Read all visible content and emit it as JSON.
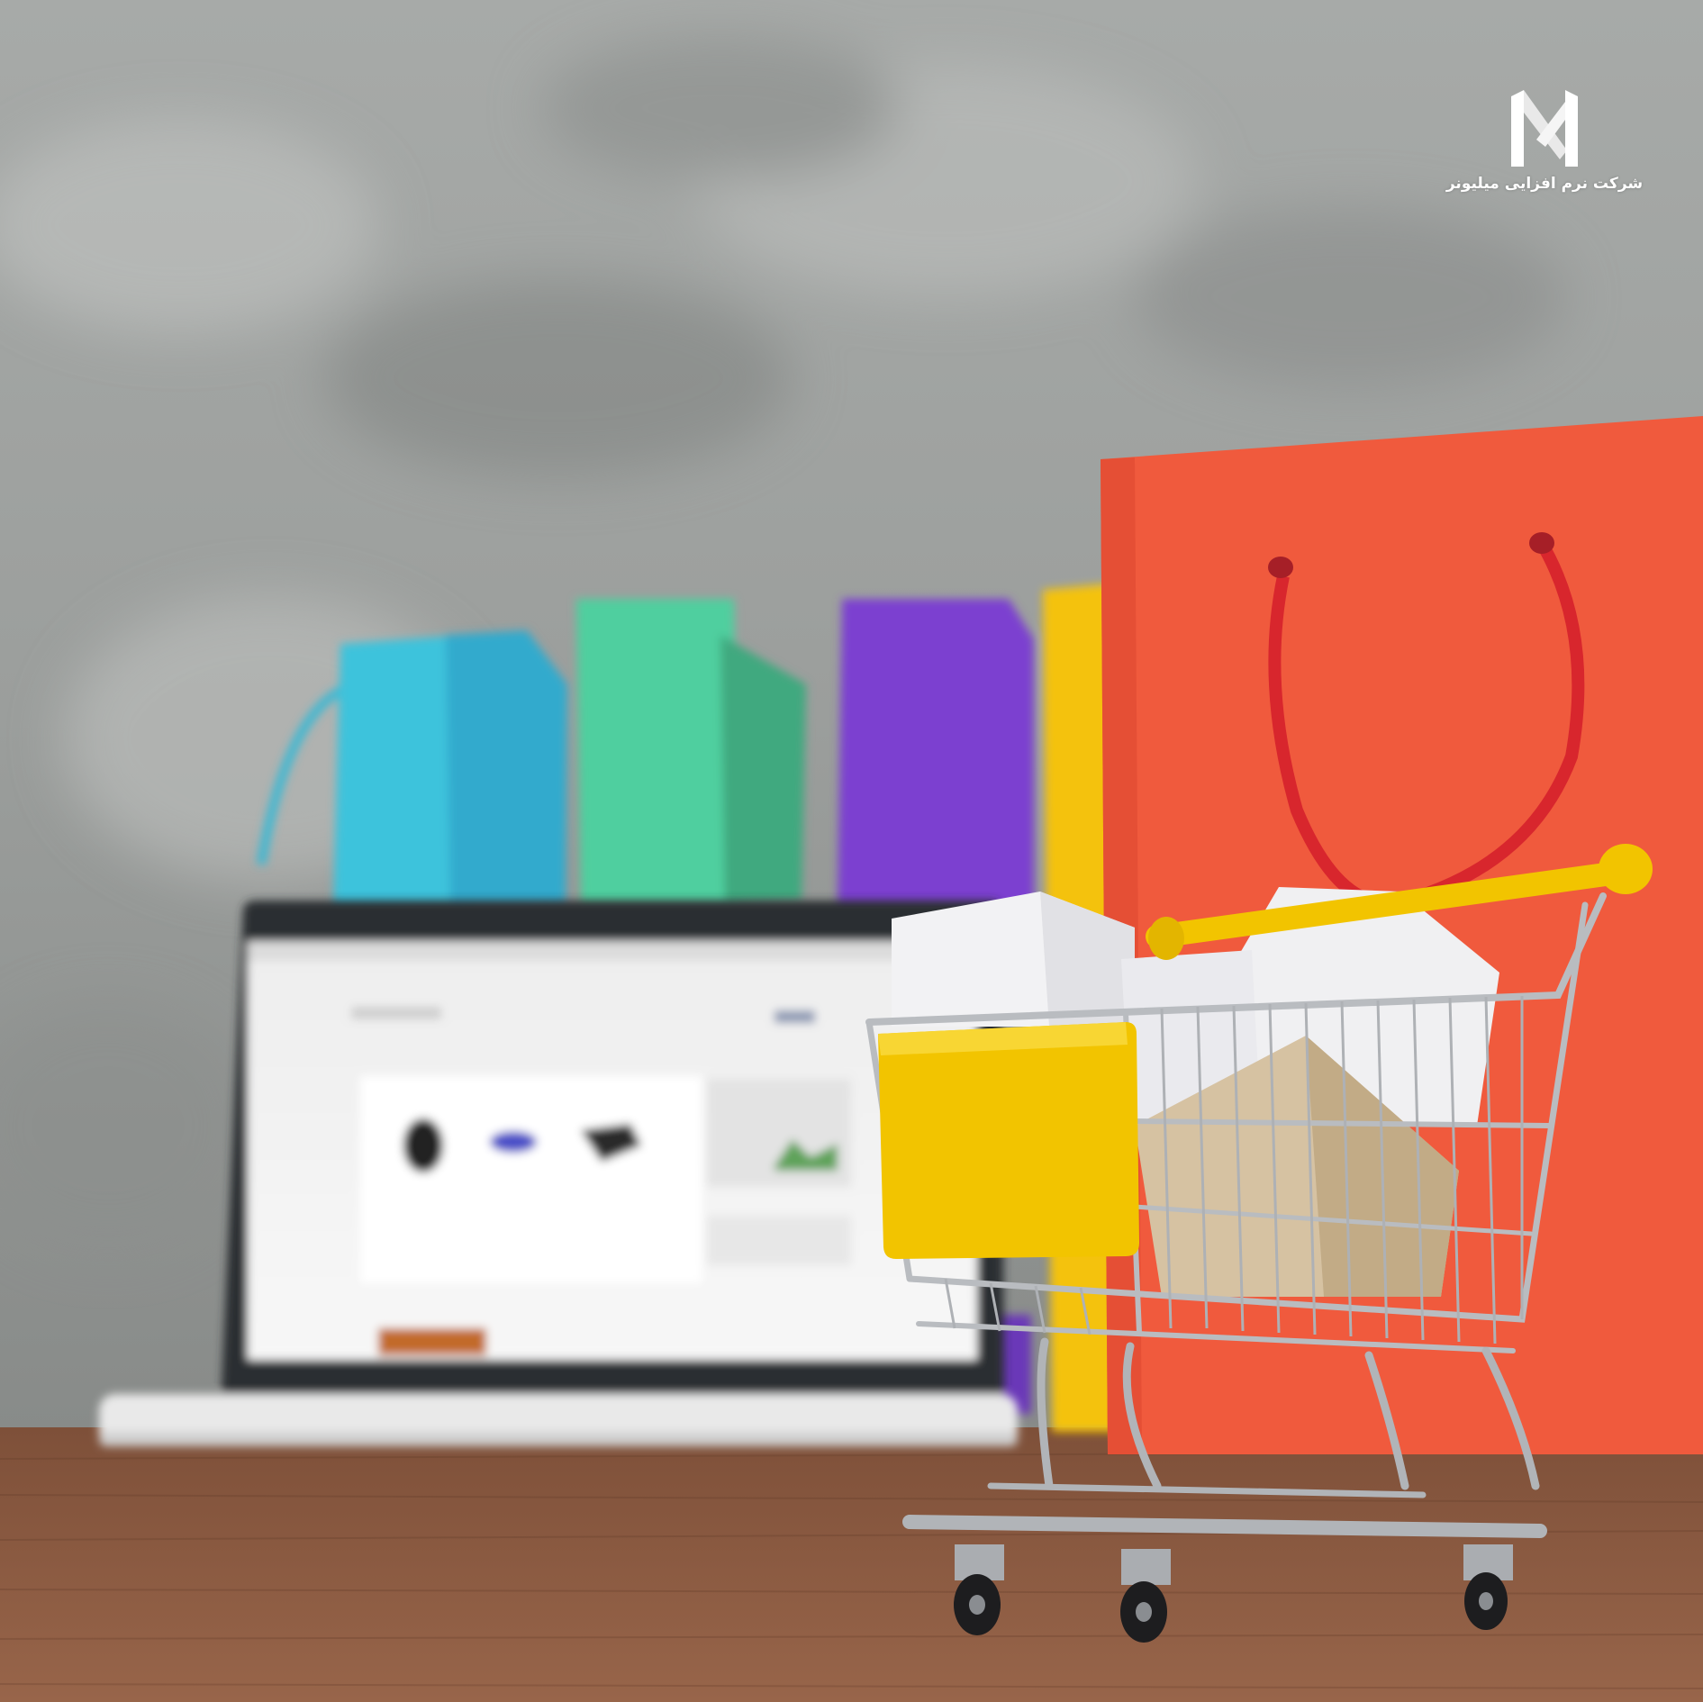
{
  "watermark": {
    "logo_icon": "stylized-m-logo-icon",
    "caption": "شرکت نرم افزایی میلیونر"
  },
  "photo": {
    "subject": "miniature shopping cart in front of laptop and shopping bags",
    "colors": {
      "wall": "#9da09e",
      "table": "#8a5a3f",
      "orange_bag": "#f05a3d",
      "bag_handle": "#d8262d",
      "cyan_bag": "#3ec3dc",
      "green_bag": "#4fcf9f",
      "purple_bag": "#7b3fd0",
      "yellow_bag": "#f4c20d",
      "cart_yellow": "#f2c400",
      "cart_metal": "#b9bcc0"
    }
  }
}
